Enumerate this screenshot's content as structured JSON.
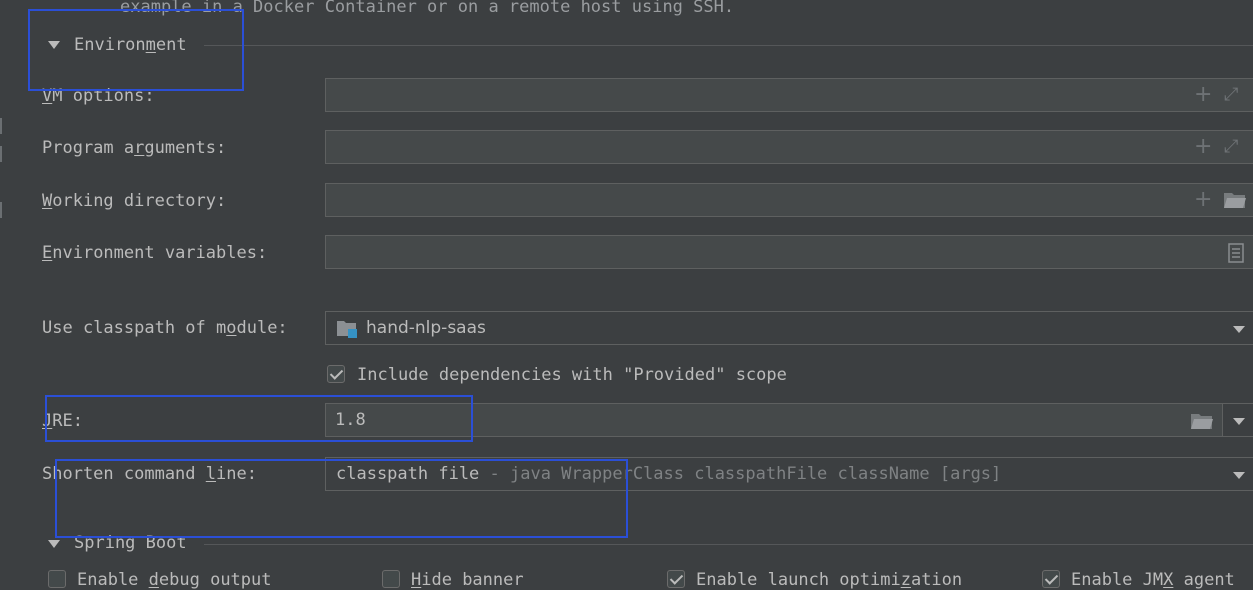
{
  "top_note": "example in a Docker Container or on a remote host using SSH.",
  "environment": {
    "title_pre": "Environ",
    "title_u": "m",
    "title_post": "ent",
    "vm_options": {
      "label_u": "V",
      "label_rest": "M options:",
      "value": ""
    },
    "program_arguments": {
      "label_pre": "Program a",
      "label_u": "r",
      "label_post": "guments:",
      "value": ""
    },
    "working_directory": {
      "label_u": "W",
      "label_rest": "orking directory:",
      "value": ""
    },
    "environment_variables": {
      "label_u": "E",
      "label_rest": "nvironment variables:",
      "value": ""
    },
    "classpath_module": {
      "label_pre": "Use classpath of m",
      "label_u": "o",
      "label_post": "dule:",
      "value": "hand-nlp-saas",
      "icon": "module-folder-icon"
    },
    "include_dependencies": {
      "label": "Include dependencies with \"Provided\" scope",
      "checked": true
    },
    "jre": {
      "label_u": "J",
      "label_rest": "RE:",
      "value": "1.8"
    },
    "shorten_command_line": {
      "label_pre": "Shorten command ",
      "label_u": "l",
      "label_post": "ine:",
      "value": "classpath file",
      "hint": " - java WrapperClass classpathFile className [args]"
    }
  },
  "spring_boot": {
    "title": "Spring Boot",
    "options": [
      {
        "pre": "Enable ",
        "u": "d",
        "post": "ebug output",
        "checked": false
      },
      {
        "pre": "",
        "u": "H",
        "post": "ide banner",
        "checked": false
      },
      {
        "pre": "Enable launch optimi",
        "u": "z",
        "post": "ation",
        "checked": true
      },
      {
        "pre": "Enable JM",
        "u": "X",
        "post": " agent",
        "checked": true
      }
    ]
  },
  "colors": {
    "background": "#3c3f41",
    "field": "#45494a",
    "text": "#bbbbbb",
    "hint": "#7f8284",
    "highlight": "#2b4fd6",
    "module_icon_accent": "#3592c4"
  }
}
